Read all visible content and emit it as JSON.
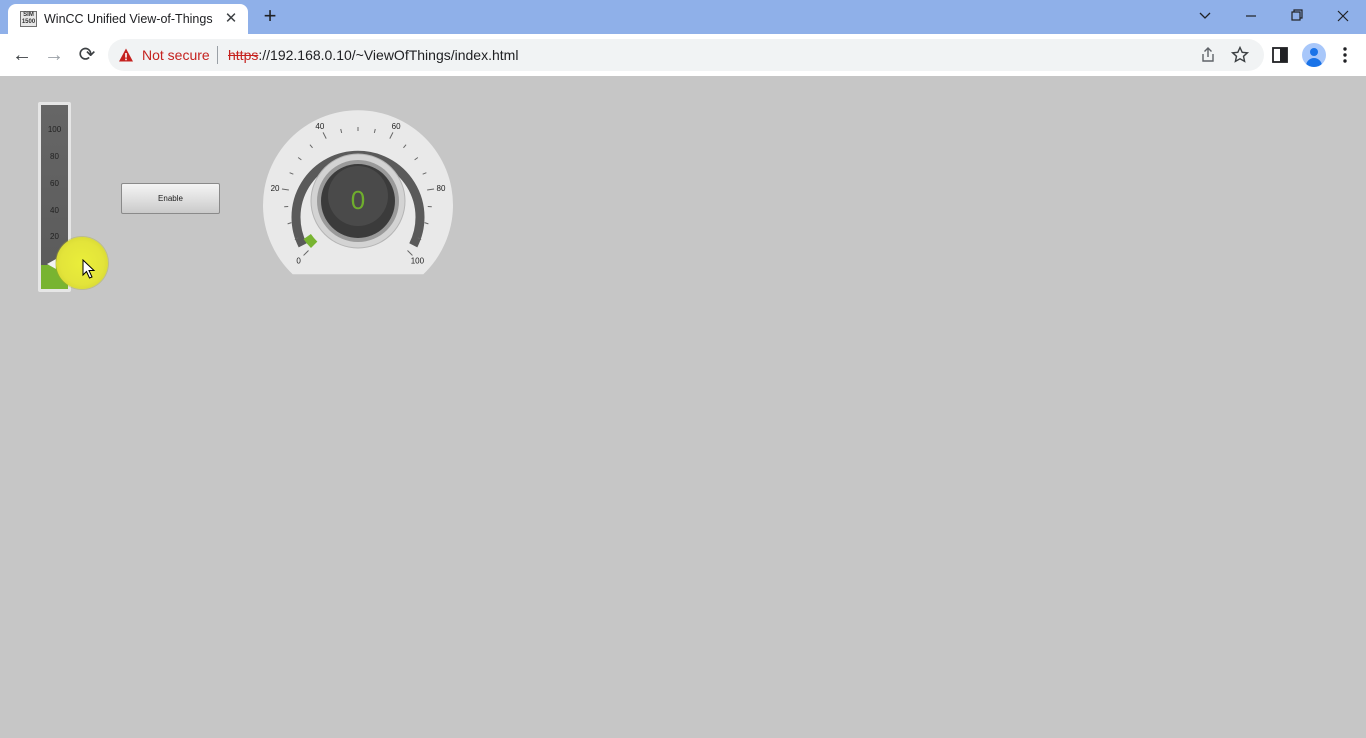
{
  "browser": {
    "tab": {
      "title": "WinCC Unified View-of-Things",
      "favicon_text": "SIM 1500",
      "close_glyph": "✕"
    },
    "new_tab_glyph": "+",
    "window_controls": [
      "chevron-down-icon",
      "minimize-icon",
      "restore-icon",
      "close-icon"
    ],
    "nav": {
      "back_glyph": "←",
      "forward_glyph": "→",
      "reload_glyph": "⟳"
    },
    "omnibox": {
      "security_label": "Not secure",
      "url_scheme": "https",
      "url_rest": "://192.168.0.10/~ViewOfThings/index.html"
    }
  },
  "hmi": {
    "slider": {
      "ticks": [
        "100",
        "80",
        "60",
        "40",
        "20"
      ],
      "value_fraction": 0.13,
      "fill_color": "#78b431"
    },
    "enable_button": {
      "label": "Enable"
    },
    "gauge": {
      "value": "0",
      "min": 0,
      "max": 100,
      "labels": [
        "0",
        "20",
        "40",
        "60",
        "80",
        "100"
      ],
      "value_color": "#6fae2d",
      "indicator_color": "#78b431"
    }
  }
}
